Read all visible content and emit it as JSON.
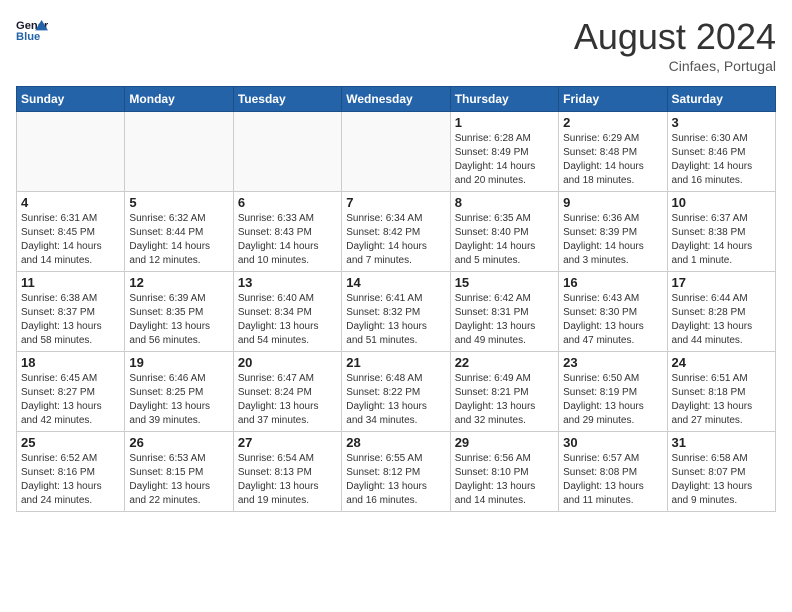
{
  "logo": {
    "line1": "General",
    "line2": "Blue"
  },
  "header": {
    "month": "August 2024",
    "location": "Cinfaes, Portugal"
  },
  "weekdays": [
    "Sunday",
    "Monday",
    "Tuesday",
    "Wednesday",
    "Thursday",
    "Friday",
    "Saturday"
  ],
  "weeks": [
    [
      {
        "day": "",
        "info": ""
      },
      {
        "day": "",
        "info": ""
      },
      {
        "day": "",
        "info": ""
      },
      {
        "day": "",
        "info": ""
      },
      {
        "day": "1",
        "info": "Sunrise: 6:28 AM\nSunset: 8:49 PM\nDaylight: 14 hours and 20 minutes."
      },
      {
        "day": "2",
        "info": "Sunrise: 6:29 AM\nSunset: 8:48 PM\nDaylight: 14 hours and 18 minutes."
      },
      {
        "day": "3",
        "info": "Sunrise: 6:30 AM\nSunset: 8:46 PM\nDaylight: 14 hours and 16 minutes."
      }
    ],
    [
      {
        "day": "4",
        "info": "Sunrise: 6:31 AM\nSunset: 8:45 PM\nDaylight: 14 hours and 14 minutes."
      },
      {
        "day": "5",
        "info": "Sunrise: 6:32 AM\nSunset: 8:44 PM\nDaylight: 14 hours and 12 minutes."
      },
      {
        "day": "6",
        "info": "Sunrise: 6:33 AM\nSunset: 8:43 PM\nDaylight: 14 hours and 10 minutes."
      },
      {
        "day": "7",
        "info": "Sunrise: 6:34 AM\nSunset: 8:42 PM\nDaylight: 14 hours and 7 minutes."
      },
      {
        "day": "8",
        "info": "Sunrise: 6:35 AM\nSunset: 8:40 PM\nDaylight: 14 hours and 5 minutes."
      },
      {
        "day": "9",
        "info": "Sunrise: 6:36 AM\nSunset: 8:39 PM\nDaylight: 14 hours and 3 minutes."
      },
      {
        "day": "10",
        "info": "Sunrise: 6:37 AM\nSunset: 8:38 PM\nDaylight: 14 hours and 1 minute."
      }
    ],
    [
      {
        "day": "11",
        "info": "Sunrise: 6:38 AM\nSunset: 8:37 PM\nDaylight: 13 hours and 58 minutes."
      },
      {
        "day": "12",
        "info": "Sunrise: 6:39 AM\nSunset: 8:35 PM\nDaylight: 13 hours and 56 minutes."
      },
      {
        "day": "13",
        "info": "Sunrise: 6:40 AM\nSunset: 8:34 PM\nDaylight: 13 hours and 54 minutes."
      },
      {
        "day": "14",
        "info": "Sunrise: 6:41 AM\nSunset: 8:32 PM\nDaylight: 13 hours and 51 minutes."
      },
      {
        "day": "15",
        "info": "Sunrise: 6:42 AM\nSunset: 8:31 PM\nDaylight: 13 hours and 49 minutes."
      },
      {
        "day": "16",
        "info": "Sunrise: 6:43 AM\nSunset: 8:30 PM\nDaylight: 13 hours and 47 minutes."
      },
      {
        "day": "17",
        "info": "Sunrise: 6:44 AM\nSunset: 8:28 PM\nDaylight: 13 hours and 44 minutes."
      }
    ],
    [
      {
        "day": "18",
        "info": "Sunrise: 6:45 AM\nSunset: 8:27 PM\nDaylight: 13 hours and 42 minutes."
      },
      {
        "day": "19",
        "info": "Sunrise: 6:46 AM\nSunset: 8:25 PM\nDaylight: 13 hours and 39 minutes."
      },
      {
        "day": "20",
        "info": "Sunrise: 6:47 AM\nSunset: 8:24 PM\nDaylight: 13 hours and 37 minutes."
      },
      {
        "day": "21",
        "info": "Sunrise: 6:48 AM\nSunset: 8:22 PM\nDaylight: 13 hours and 34 minutes."
      },
      {
        "day": "22",
        "info": "Sunrise: 6:49 AM\nSunset: 8:21 PM\nDaylight: 13 hours and 32 minutes."
      },
      {
        "day": "23",
        "info": "Sunrise: 6:50 AM\nSunset: 8:19 PM\nDaylight: 13 hours and 29 minutes."
      },
      {
        "day": "24",
        "info": "Sunrise: 6:51 AM\nSunset: 8:18 PM\nDaylight: 13 hours and 27 minutes."
      }
    ],
    [
      {
        "day": "25",
        "info": "Sunrise: 6:52 AM\nSunset: 8:16 PM\nDaylight: 13 hours and 24 minutes."
      },
      {
        "day": "26",
        "info": "Sunrise: 6:53 AM\nSunset: 8:15 PM\nDaylight: 13 hours and 22 minutes."
      },
      {
        "day": "27",
        "info": "Sunrise: 6:54 AM\nSunset: 8:13 PM\nDaylight: 13 hours and 19 minutes."
      },
      {
        "day": "28",
        "info": "Sunrise: 6:55 AM\nSunset: 8:12 PM\nDaylight: 13 hours and 16 minutes."
      },
      {
        "day": "29",
        "info": "Sunrise: 6:56 AM\nSunset: 8:10 PM\nDaylight: 13 hours and 14 minutes."
      },
      {
        "day": "30",
        "info": "Sunrise: 6:57 AM\nSunset: 8:08 PM\nDaylight: 13 hours and 11 minutes."
      },
      {
        "day": "31",
        "info": "Sunrise: 6:58 AM\nSunset: 8:07 PM\nDaylight: 13 hours and 9 minutes."
      }
    ]
  ]
}
